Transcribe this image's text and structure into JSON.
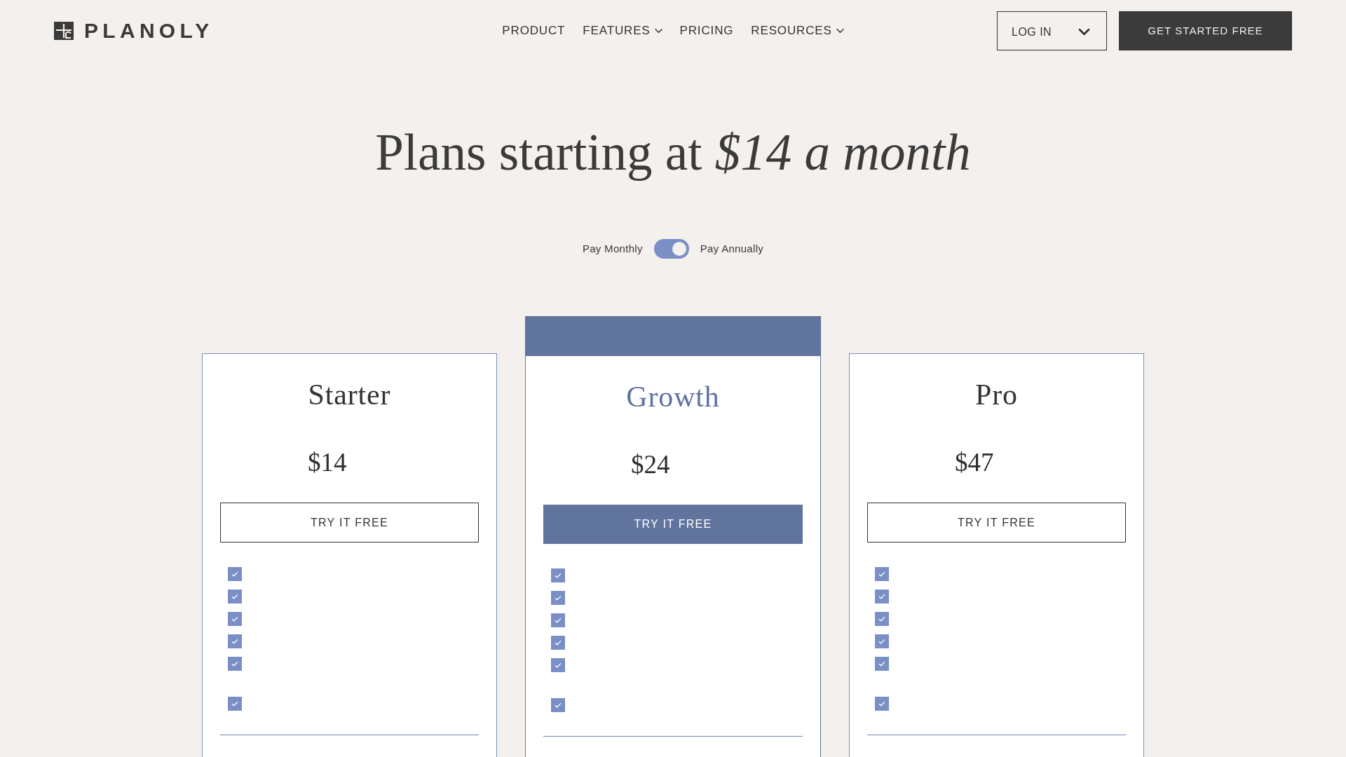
{
  "header": {
    "logo": {
      "text": "PLANOLY"
    },
    "nav": [
      {
        "label": "PRODUCT",
        "dropdown": false
      },
      {
        "label": "FEATURES",
        "dropdown": true
      },
      {
        "label": "PRICING",
        "dropdown": false
      },
      {
        "label": "RESOURCES",
        "dropdown": true
      }
    ],
    "login": {
      "label": "LOG IN"
    },
    "cta": {
      "label": "GET STARTED FREE"
    }
  },
  "hero": {
    "heading": "Plans starting at *$14 a month*"
  },
  "billing": {
    "left_label": "Pay Monthly",
    "right_label": "Pay Annually",
    "on": true
  },
  "plans": [
    {
      "name": "Starter",
      "price": "$14",
      "button": "TRY IT FREE",
      "featured": false,
      "feature_groups": [
        [
          {
            "checked": true
          },
          {
            "checked": true
          },
          {
            "checked": true
          },
          {
            "checked": true
          },
          {
            "checked": true
          }
        ],
        [
          {
            "checked": true
          }
        ]
      ]
    },
    {
      "name": "Growth",
      "price": "$24",
      "button": "TRY IT FREE",
      "featured": true,
      "feature_groups": [
        [
          {
            "checked": true
          },
          {
            "checked": true
          },
          {
            "checked": true
          },
          {
            "checked": true
          },
          {
            "checked": true
          }
        ],
        [
          {
            "checked": true
          }
        ]
      ]
    },
    {
      "name": "Pro",
      "price": "$47",
      "button": "TRY IT FREE",
      "featured": false,
      "feature_groups": [
        [
          {
            "checked": true
          },
          {
            "checked": true
          },
          {
            "checked": true
          },
          {
            "checked": true
          },
          {
            "checked": true
          }
        ],
        [
          {
            "checked": true
          }
        ]
      ]
    }
  ]
}
